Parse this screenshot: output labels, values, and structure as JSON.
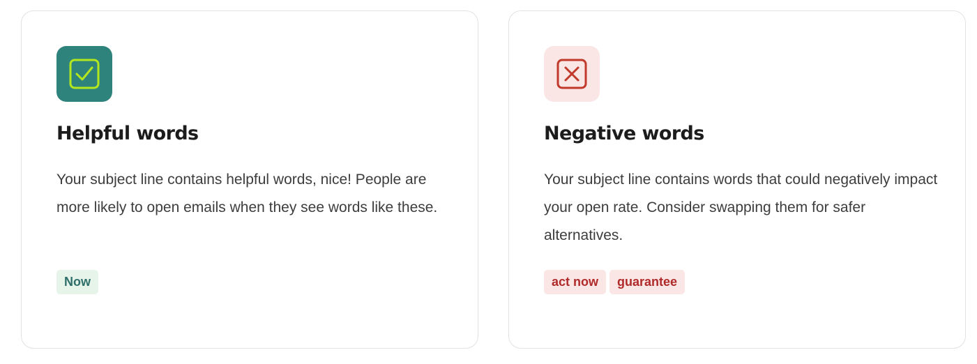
{
  "cards": [
    {
      "kind": "positive",
      "icon": "checkbox-checked-icon",
      "title": "Helpful words",
      "description": "Your subject line contains helpful words, nice! People are more likely to open emails when they see words like these.",
      "tags": [
        "Now"
      ]
    },
    {
      "kind": "negative",
      "icon": "checkbox-x-icon",
      "title": "Negative words",
      "description": "Your subject line contains words that could negatively impact your open rate. Consider swapping them for safer alternatives.",
      "tags": [
        "act now",
        "guarantee"
      ]
    }
  ],
  "colors": {
    "positive_tile": "#2e847c",
    "positive_icon": "#b4e61e",
    "negative_tile": "#f9e6e5",
    "negative_icon": "#c0392b"
  }
}
